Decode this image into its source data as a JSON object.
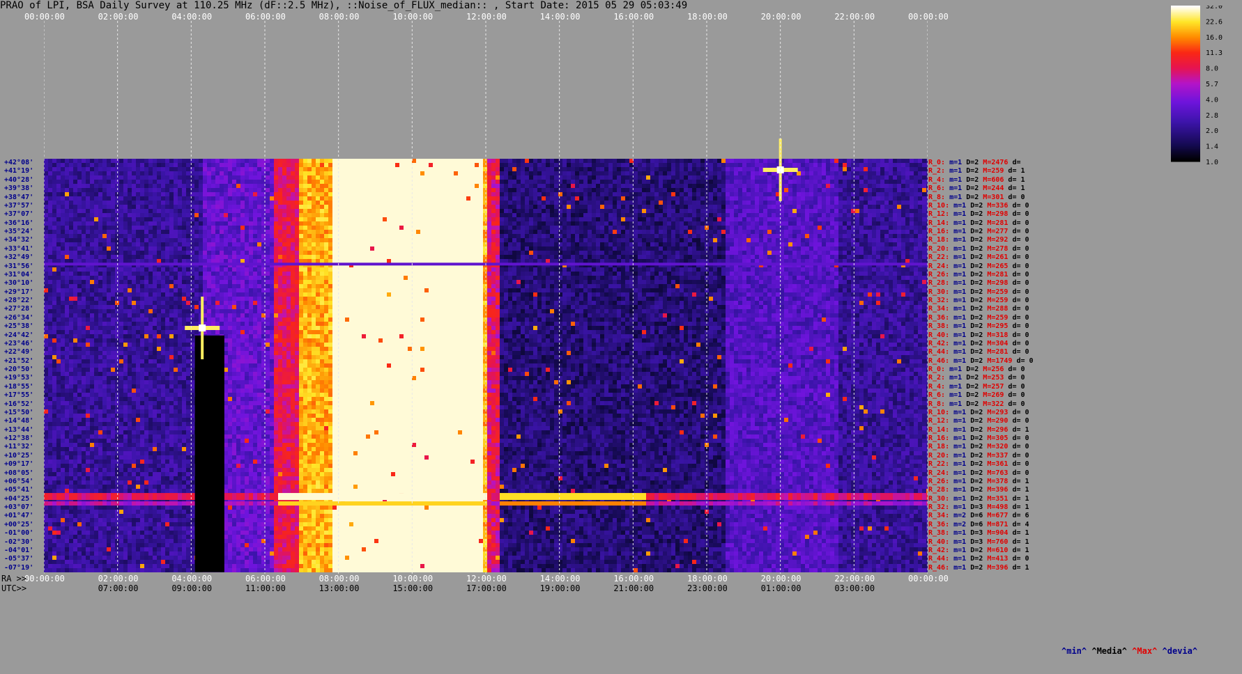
{
  "title": "PRAO of LPI, BSA Daily Survey at 110.25 MHz (dF::2.5 MHz), ::Noise_of_FLUX_median:: , Start Date: 2015 05 29 05:03:49",
  "top_axis_ticks": [
    "00:00:00",
    "02:00:00",
    "04:00:00",
    "06:00:00",
    "08:00:00",
    "10:00:00",
    "12:00:00",
    "14:00:00",
    "16:00:00",
    "18:00:00",
    "20:00:00",
    "22:00:00",
    "00:00:00"
  ],
  "ra_label": "RA >>",
  "utc_label": "UTC>>",
  "ra_ticks": [
    "00:00:00",
    "02:00:00",
    "04:00:00",
    "06:00:00",
    "08:00:00",
    "10:00:00",
    "12:00:00",
    "14:00:00",
    "16:00:00",
    "18:00:00",
    "20:00:00",
    "22:00:00",
    "00:00:00"
  ],
  "utc_ticks": [
    "07:00:00",
    "09:00:00",
    "11:00:00",
    "13:00:00",
    "15:00:00",
    "17:00:00",
    "19:00:00",
    "21:00:00",
    "23:00:00",
    "01:00:00",
    "03:00:00"
  ],
  "dec_labels": [
    "+42°08'",
    "+41°19'",
    "+40°28'",
    "+39°38'",
    "+38°47'",
    "+37°57'",
    "+37°07'",
    "+36°16'",
    "+35°24'",
    "+34°32'",
    "+33°41'",
    "+32°49'",
    "+31°56'",
    "+31°04'",
    "+30°10'",
    "+29°17'",
    "+28°22'",
    "+27°28'",
    "+26°34'",
    "+25°38'",
    "+24°42'",
    "+23°46'",
    "+22°49'",
    "+21°52'",
    "+20°50'",
    "+19°53'",
    "+18°55'",
    "+17°55'",
    "+16°52'",
    "+15°50'",
    "+14°48'",
    "+13°44'",
    "+12°38'",
    "+11°32'",
    "+10°25'",
    "+09°17'",
    "+08°05'",
    "+06°54'",
    "+05°41'",
    "+04°25'",
    "+03°07'",
    "+01°47'",
    "+00°25'",
    "-01°00'",
    "-02°30'",
    "-04°01'",
    "-05°37'",
    "-07°19'"
  ],
  "stats_rows": [
    {
      "r": "R_0:",
      "m": "m=1",
      "d": "D=2",
      "M": "M=2476",
      "dev": "d="
    },
    {
      "r": "R_2:",
      "m": "m=1",
      "d": "D=2",
      "M": "M=259",
      "dev": "d= 1"
    },
    {
      "r": "R_4:",
      "m": "m=1",
      "d": "D=2",
      "M": "M=606",
      "dev": "d= 1"
    },
    {
      "r": "R_6:",
      "m": "m=1",
      "d": "D=2",
      "M": "M=244",
      "dev": "d= 1"
    },
    {
      "r": "R_8:",
      "m": "m=1",
      "d": "D=2",
      "M": "M=301",
      "dev": "d= 0"
    },
    {
      "r": "R_10:",
      "m": "m=1",
      "d": "D=2",
      "M": "M=336",
      "dev": "d= 0"
    },
    {
      "r": "R_12:",
      "m": "m=1",
      "d": "D=2",
      "M": "M=298",
      "dev": "d= 0"
    },
    {
      "r": "R_14:",
      "m": "m=1",
      "d": "D=2",
      "M": "M=281",
      "dev": "d= 0"
    },
    {
      "r": "R_16:",
      "m": "m=1",
      "d": "D=2",
      "M": "M=277",
      "dev": "d= 0"
    },
    {
      "r": "R_18:",
      "m": "m=1",
      "d": "D=2",
      "M": "M=292",
      "dev": "d= 0"
    },
    {
      "r": "R_20:",
      "m": "m=1",
      "d": "D=2",
      "M": "M=278",
      "dev": "d= 0"
    },
    {
      "r": "R_22:",
      "m": "m=1",
      "d": "D=2",
      "M": "M=261",
      "dev": "d= 0"
    },
    {
      "r": "R_24:",
      "m": "m=1",
      "d": "D=2",
      "M": "M=265",
      "dev": "d= 0"
    },
    {
      "r": "R_26:",
      "m": "m=1",
      "d": "D=2",
      "M": "M=281",
      "dev": "d= 0"
    },
    {
      "r": "R_28:",
      "m": "m=1",
      "d": "D=2",
      "M": "M=298",
      "dev": "d= 0"
    },
    {
      "r": "R_30:",
      "m": "m=1",
      "d": "D=2",
      "M": "M=259",
      "dev": "d= 0"
    },
    {
      "r": "R_32:",
      "m": "m=1",
      "d": "D=2",
      "M": "M=259",
      "dev": "d= 0"
    },
    {
      "r": "R_34:",
      "m": "m=1",
      "d": "D=2",
      "M": "M=288",
      "dev": "d= 0"
    },
    {
      "r": "R_36:",
      "m": "m=1",
      "d": "D=2",
      "M": "M=259",
      "dev": "d= 0"
    },
    {
      "r": "R_38:",
      "m": "m=1",
      "d": "D=2",
      "M": "M=295",
      "dev": "d= 0"
    },
    {
      "r": "R_40:",
      "m": "m=1",
      "d": "D=2",
      "M": "M=318",
      "dev": "d= 0"
    },
    {
      "r": "R_42:",
      "m": "m=1",
      "d": "D=2",
      "M": "M=304",
      "dev": "d= 0"
    },
    {
      "r": "R_44:",
      "m": "m=1",
      "d": "D=2",
      "M": "M=281",
      "dev": "d= 0"
    },
    {
      "r": "R_46:",
      "m": "m=1",
      "d": "D=2",
      "M": "M=1749",
      "dev": "d= 0"
    },
    {
      "r": "R_0:",
      "m": "m=1",
      "d": "D=2",
      "M": "M=256",
      "dev": "d= 0"
    },
    {
      "r": "R_2:",
      "m": "m=1",
      "d": "D=2",
      "M": "M=253",
      "dev": "d= 0"
    },
    {
      "r": "R_4:",
      "m": "m=1",
      "d": "D=2",
      "M": "M=257",
      "dev": "d= 0"
    },
    {
      "r": "R_6:",
      "m": "m=1",
      "d": "D=2",
      "M": "M=269",
      "dev": "d= 0"
    },
    {
      "r": "R_8:",
      "m": "m=1",
      "d": "D=2",
      "M": "M=322",
      "dev": "d= 0"
    },
    {
      "r": "R_10:",
      "m": "m=1",
      "d": "D=2",
      "M": "M=293",
      "dev": "d= 0"
    },
    {
      "r": "R_12:",
      "m": "m=1",
      "d": "D=2",
      "M": "M=290",
      "dev": "d= 0"
    },
    {
      "r": "R_14:",
      "m": "m=1",
      "d": "D=2",
      "M": "M=296",
      "dev": "d= 1"
    },
    {
      "r": "R_16:",
      "m": "m=1",
      "d": "D=2",
      "M": "M=305",
      "dev": "d= 0"
    },
    {
      "r": "R_18:",
      "m": "m=1",
      "d": "D=2",
      "M": "M=320",
      "dev": "d= 0"
    },
    {
      "r": "R_20:",
      "m": "m=1",
      "d": "D=2",
      "M": "M=337",
      "dev": "d= 0"
    },
    {
      "r": "R_22:",
      "m": "m=1",
      "d": "D=2",
      "M": "M=361",
      "dev": "d= 0"
    },
    {
      "r": "R_24:",
      "m": "m=1",
      "d": "D=2",
      "M": "M=763",
      "dev": "d= 0"
    },
    {
      "r": "R_26:",
      "m": "m=1",
      "d": "D=2",
      "M": "M=378",
      "dev": "d= 1"
    },
    {
      "r": "R_28:",
      "m": "m=1",
      "d": "D=2",
      "M": "M=396",
      "dev": "d= 1"
    },
    {
      "r": "R_30:",
      "m": "m=1",
      "d": "D=2",
      "M": "M=351",
      "dev": "d= 1"
    },
    {
      "r": "R_32:",
      "m": "m=1",
      "d": "D=3",
      "M": "M=498",
      "dev": "d= 1"
    },
    {
      "r": "R_34:",
      "m": "m=2",
      "d": "D=6",
      "M": "M=677",
      "dev": "d= 6"
    },
    {
      "r": "R_36:",
      "m": "m=2",
      "d": "D=6",
      "M": "M=871",
      "dev": "d= 4"
    },
    {
      "r": "R_38:",
      "m": "m=1",
      "d": "D=3",
      "M": "M=904",
      "dev": "d= 1"
    },
    {
      "r": "R_40:",
      "m": "m=1",
      "d": "D=3",
      "M": "M=760",
      "dev": "d= 1"
    },
    {
      "r": "R_42:",
      "m": "m=1",
      "d": "D=2",
      "M": "M=610",
      "dev": "d= 1"
    },
    {
      "r": "R_44:",
      "m": "m=1",
      "d": "D=2",
      "M": "M=413",
      "dev": "d= 0"
    },
    {
      "r": "R_46:",
      "m": "m=1",
      "d": "D=2",
      "M": "M=396",
      "dev": "d= 1"
    }
  ],
  "bottom_legend": {
    "min": "^min^",
    "media": "^Media^",
    "max": "^Max^",
    "devia": "^devia^"
  },
  "colors": {
    "stats_r": "#e00000",
    "stats_m": "#00008b",
    "stats_d": "#000000",
    "stats_M": "#e00000",
    "dec": "#00008b",
    "legend_min": "#00008b",
    "legend_media": "#000000",
    "legend_max": "#e00000",
    "legend_devia": "#00008b"
  },
  "colorbar": {
    "ticks": [
      "32.0",
      "22.6",
      "16.0",
      "11.3",
      "8.0",
      "5.7",
      "4.0",
      "2.8",
      "2.0",
      "1.4",
      "1.0"
    ]
  },
  "chart_data": {
    "type": "heatmap",
    "title": "PRAO of LPI, BSA Daily Survey at 110.25 MHz (dF::2.5 MHz), ::Noise_of_FLUX_median:: , Start Date: 2015 05 29 05:03:49",
    "x_axis": "RA / UTC hours",
    "x_range_hours": [
      0,
      24
    ],
    "y_axis": "Declination",
    "y_range_deg": [
      42.13,
      -7.32
    ],
    "colorbar_range": [
      1.0,
      32.0
    ],
    "colorbar_scale": "log",
    "features": [
      {
        "name": "strong broadband emission",
        "ra_start_h": 6.9,
        "ra_end_h": 12.0,
        "peak": 32.0
      },
      {
        "name": "red emission",
        "ra_start_h": 6.2,
        "ra_end_h": 8.4,
        "peak": 8.0
      },
      {
        "name": "source (Cyg-like)",
        "ra_h": 20.0,
        "dec_deg": 40.8,
        "peak": 32.0
      },
      {
        "name": "source",
        "ra_h": 4.3,
        "dec_deg": 21.9,
        "peak": 22.6
      },
      {
        "name": "low-dec bright band",
        "ra_start_h": 12.3,
        "ra_end_h": 16.3,
        "dec_deg": 1.0,
        "peak": 22.6
      },
      {
        "name": "blank gap",
        "ra_start_h": 4.1,
        "ra_end_h": 4.9,
        "dec_from_deg": 21.0,
        "dec_to_deg": -7.3
      }
    ]
  }
}
